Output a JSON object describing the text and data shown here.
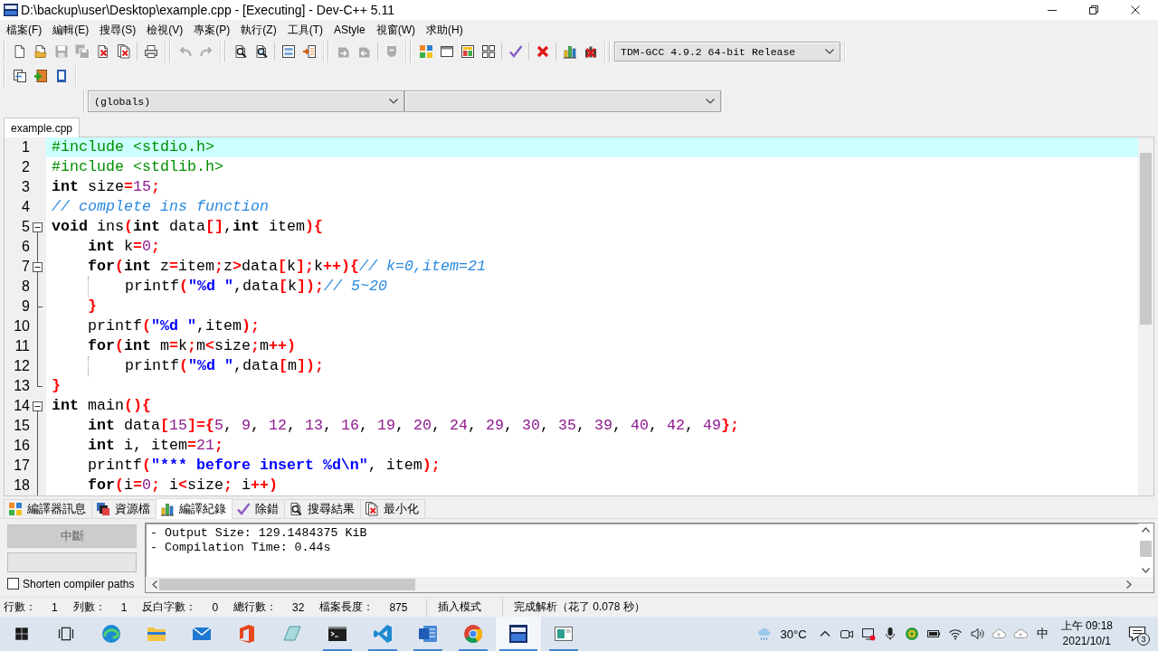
{
  "window": {
    "title": "D:\\backup\\user\\Desktop\\example.cpp - [Executing] - Dev-C++ 5.11"
  },
  "menu_bar": [
    "檔案(F)",
    "編輯(E)",
    "搜尋(S)",
    "檢視(V)",
    "專案(P)",
    "執行(Z)",
    "工具(T)",
    "AStyle",
    "視窗(W)",
    "求助(H)"
  ],
  "toolbar_rows": [
    {
      "bands": [
        {
          "groups": [
            [
              {
                "kind": "new",
                "disabled": false
              },
              {
                "kind": "open",
                "disabled": false
              },
              {
                "kind": "save",
                "disabled": true
              },
              {
                "kind": "saveall",
                "disabled": true
              },
              {
                "kind": "close",
                "disabled": false
              },
              {
                "kind": "closeall",
                "disabled": false
              }
            ],
            [
              {
                "kind": "print",
                "disabled": false
              }
            ]
          ]
        },
        {
          "groups": [
            [
              {
                "kind": "undo",
                "disabled": true
              },
              {
                "kind": "redo",
                "disabled": true
              }
            ]
          ]
        },
        {
          "groups": [
            [
              {
                "kind": "find",
                "disabled": false
              },
              {
                "kind": "replace",
                "disabled": false
              }
            ],
            [
              {
                "kind": "panel",
                "disabled": false
              },
              {
                "kind": "goto",
                "disabled": false
              }
            ]
          ]
        },
        {
          "groups": [
            [
              {
                "kind": "fileadd",
                "disabled": true
              },
              {
                "kind": "fileremove",
                "disabled": true
              }
            ],
            [
              {
                "kind": "options",
                "disabled": true
              }
            ]
          ]
        },
        {
          "groups": [
            [
              {
                "kind": "compile",
                "disabled": false
              },
              {
                "kind": "run",
                "disabled": false
              },
              {
                "kind": "compilerun",
                "disabled": false
              },
              {
                "kind": "rebuild",
                "disabled": false
              }
            ],
            [
              {
                "kind": "check",
                "disabled": false
              }
            ],
            [
              {
                "kind": "stop",
                "disabled": false
              }
            ],
            [
              {
                "kind": "profile",
                "disabled": false
              },
              {
                "kind": "deleteprofile",
                "disabled": false
              }
            ]
          ]
        }
      ]
    },
    {
      "bands": [
        {
          "groups": [
            [
              {
                "kind": "frames",
                "disabled": false
              },
              {
                "kind": "addfile",
                "disabled": false
              },
              {
                "kind": "book",
                "disabled": false
              }
            ]
          ]
        }
      ]
    }
  ],
  "compiler_select": {
    "value": "TDM-GCC 4.9.2 64-bit Release"
  },
  "scope_select": {
    "value": "(globals)"
  },
  "editor_tabs": [
    {
      "label": "example.cpp",
      "selected": true
    }
  ],
  "editor": {
    "lines": [
      {
        "number": "1",
        "current": true,
        "kind": "plain",
        "tokens": [
          {
            "kind": "pre",
            "text": "#include <stdio.h>"
          }
        ]
      },
      {
        "number": "2",
        "current": false,
        "kind": "plain",
        "tokens": [
          {
            "kind": "pre",
            "text": "#include <stdlib.h>"
          }
        ]
      },
      {
        "number": "3",
        "current": false,
        "kind": "plain",
        "tokens": [
          {
            "kind": "kw",
            "text": "int"
          },
          {
            "kind": "id",
            "text": " size"
          },
          {
            "kind": "sym",
            "text": "="
          },
          {
            "kind": "num",
            "text": "15"
          },
          {
            "kind": "sym",
            "text": ";"
          }
        ]
      },
      {
        "number": "4",
        "current": false,
        "kind": "plain",
        "tokens": [
          {
            "kind": "cmt",
            "text": "// complete ins function"
          }
        ]
      },
      {
        "number": "5",
        "current": false,
        "kind": "start",
        "tokens": [
          {
            "kind": "kw",
            "text": "void"
          },
          {
            "kind": "id",
            "text": " ins"
          },
          {
            "kind": "sym",
            "text": "("
          },
          {
            "kind": "kw",
            "text": "int"
          },
          {
            "kind": "id",
            "text": " data"
          },
          {
            "kind": "sym",
            "text": "[]"
          },
          {
            "kind": "id",
            "text": ","
          },
          {
            "kind": "kw",
            "text": "int"
          },
          {
            "kind": "id",
            "text": " item"
          },
          {
            "kind": "sym",
            "text": "){"
          }
        ]
      },
      {
        "number": "6",
        "current": false,
        "kind": "body",
        "tokens": [
          {
            "kind": "kw",
            "text": "    int"
          },
          {
            "kind": "id",
            "text": " k"
          },
          {
            "kind": "sym",
            "text": "="
          },
          {
            "kind": "num",
            "text": "0"
          },
          {
            "kind": "sym",
            "text": ";"
          }
        ]
      },
      {
        "number": "7",
        "current": false,
        "kind": "branch",
        "tokens": [
          {
            "kind": "kw",
            "text": "    for"
          },
          {
            "kind": "sym",
            "text": "("
          },
          {
            "kind": "kw",
            "text": "int"
          },
          {
            "kind": "id",
            "text": " z"
          },
          {
            "kind": "sym",
            "text": "="
          },
          {
            "kind": "id",
            "text": "item"
          },
          {
            "kind": "sym",
            "text": ";"
          },
          {
            "kind": "id",
            "text": "z"
          },
          {
            "kind": "sym",
            "text": ">"
          },
          {
            "kind": "id",
            "text": "data"
          },
          {
            "kind": "sym",
            "text": "["
          },
          {
            "kind": "id",
            "text": "k"
          },
          {
            "kind": "sym",
            "text": "];"
          },
          {
            "kind": "id",
            "text": "k"
          },
          {
            "kind": "sym",
            "text": "++){"
          },
          {
            "kind": "cmt",
            "text": "// k=0,item=21"
          }
        ]
      },
      {
        "number": "8",
        "current": false,
        "kind": "body",
        "tokens": [
          {
            "kind": "id",
            "text": "        printf"
          },
          {
            "kind": "sym",
            "text": "("
          },
          {
            "kind": "str",
            "text": "\"%d \""
          },
          {
            "kind": "id",
            "text": ",data"
          },
          {
            "kind": "sym",
            "text": "["
          },
          {
            "kind": "id",
            "text": "k"
          },
          {
            "kind": "sym",
            "text": "]);"
          },
          {
            "kind": "cmt",
            "text": "// 5~20"
          }
        ]
      },
      {
        "number": "9",
        "current": false,
        "kind": "tee",
        "tokens": [
          {
            "kind": "sym",
            "text": "    }"
          }
        ]
      },
      {
        "number": "10",
        "current": false,
        "kind": "body",
        "tokens": [
          {
            "kind": "id",
            "text": "    printf"
          },
          {
            "kind": "sym",
            "text": "("
          },
          {
            "kind": "str",
            "text": "\"%d \""
          },
          {
            "kind": "id",
            "text": ",item"
          },
          {
            "kind": "sym",
            "text": ");"
          }
        ]
      },
      {
        "number": "11",
        "current": false,
        "kind": "body",
        "tokens": [
          {
            "kind": "kw",
            "text": "    for"
          },
          {
            "kind": "sym",
            "text": "("
          },
          {
            "kind": "kw",
            "text": "int"
          },
          {
            "kind": "id",
            "text": " m"
          },
          {
            "kind": "sym",
            "text": "="
          },
          {
            "kind": "id",
            "text": "k"
          },
          {
            "kind": "sym",
            "text": ";"
          },
          {
            "kind": "id",
            "text": "m"
          },
          {
            "kind": "sym",
            "text": "<"
          },
          {
            "kind": "id",
            "text": "size"
          },
          {
            "kind": "sym",
            "text": ";"
          },
          {
            "kind": "id",
            "text": "m"
          },
          {
            "kind": "sym",
            "text": "++)"
          }
        ]
      },
      {
        "number": "12",
        "current": false,
        "kind": "body",
        "tokens": [
          {
            "kind": "id",
            "text": "        printf"
          },
          {
            "kind": "sym",
            "text": "("
          },
          {
            "kind": "str",
            "text": "\"%d \""
          },
          {
            "kind": "id",
            "text": ",data"
          },
          {
            "kind": "sym",
            "text": "["
          },
          {
            "kind": "id",
            "text": "m"
          },
          {
            "kind": "sym",
            "text": "]);"
          }
        ]
      },
      {
        "number": "13",
        "current": false,
        "kind": "end",
        "tokens": [
          {
            "kind": "sym",
            "text": "}"
          }
        ]
      },
      {
        "number": "14",
        "current": false,
        "kind": "start",
        "tokens": [
          {
            "kind": "kw",
            "text": "int"
          },
          {
            "kind": "id",
            "text": " main"
          },
          {
            "kind": "sym",
            "text": "(){"
          }
        ]
      },
      {
        "number": "15",
        "current": false,
        "kind": "body",
        "tokens": [
          {
            "kind": "kw",
            "text": "    int"
          },
          {
            "kind": "id",
            "text": " data"
          },
          {
            "kind": "sym",
            "text": "["
          },
          {
            "kind": "num",
            "text": "15"
          },
          {
            "kind": "sym",
            "text": "]={"
          },
          {
            "kind": "num",
            "text": "5"
          },
          {
            "kind": "id",
            "text": ", "
          },
          {
            "kind": "num",
            "text": "9"
          },
          {
            "kind": "id",
            "text": ", "
          },
          {
            "kind": "num",
            "text": "12"
          },
          {
            "kind": "id",
            "text": ", "
          },
          {
            "kind": "num",
            "text": "13"
          },
          {
            "kind": "id",
            "text": ", "
          },
          {
            "kind": "num",
            "text": "16"
          },
          {
            "kind": "id",
            "text": ", "
          },
          {
            "kind": "num",
            "text": "19"
          },
          {
            "kind": "id",
            "text": ", "
          },
          {
            "kind": "num",
            "text": "20"
          },
          {
            "kind": "id",
            "text": ", "
          },
          {
            "kind": "num",
            "text": "24"
          },
          {
            "kind": "id",
            "text": ", "
          },
          {
            "kind": "num",
            "text": "29"
          },
          {
            "kind": "id",
            "text": ", "
          },
          {
            "kind": "num",
            "text": "30"
          },
          {
            "kind": "id",
            "text": ", "
          },
          {
            "kind": "num",
            "text": "35"
          },
          {
            "kind": "id",
            "text": ", "
          },
          {
            "kind": "num",
            "text": "39"
          },
          {
            "kind": "id",
            "text": ", "
          },
          {
            "kind": "num",
            "text": "40"
          },
          {
            "kind": "id",
            "text": ", "
          },
          {
            "kind": "num",
            "text": "42"
          },
          {
            "kind": "id",
            "text": ", "
          },
          {
            "kind": "num",
            "text": "49"
          },
          {
            "kind": "sym",
            "text": "};"
          }
        ]
      },
      {
        "number": "16",
        "current": false,
        "kind": "body",
        "tokens": [
          {
            "kind": "kw",
            "text": "    int"
          },
          {
            "kind": "id",
            "text": " i, item"
          },
          {
            "kind": "sym",
            "text": "="
          },
          {
            "kind": "num",
            "text": "21"
          },
          {
            "kind": "sym",
            "text": ";"
          }
        ]
      },
      {
        "number": "17",
        "current": false,
        "kind": "body",
        "tokens": [
          {
            "kind": "id",
            "text": "    printf"
          },
          {
            "kind": "sym",
            "text": "("
          },
          {
            "kind": "str",
            "text": "\"*** before insert %d\\n\""
          },
          {
            "kind": "id",
            "text": ", item"
          },
          {
            "kind": "sym",
            "text": ");"
          }
        ]
      },
      {
        "number": "18",
        "current": false,
        "kind": "body",
        "tokens": [
          {
            "kind": "kw",
            "text": "    for"
          },
          {
            "kind": "sym",
            "text": "("
          },
          {
            "kind": "id",
            "text": "i"
          },
          {
            "kind": "sym",
            "text": "="
          },
          {
            "kind": "num",
            "text": "0"
          },
          {
            "kind": "sym",
            "text": ";"
          },
          {
            "kind": "id",
            "text": " i"
          },
          {
            "kind": "sym",
            "text": "<"
          },
          {
            "kind": "id",
            "text": "size"
          },
          {
            "kind": "sym",
            "text": ";"
          },
          {
            "kind": "id",
            "text": " i"
          },
          {
            "kind": "sym",
            "text": "++)"
          }
        ]
      }
    ]
  },
  "panel_tabs": [
    {
      "label": "編譯器訊息",
      "kind": "compile",
      "selected": false
    },
    {
      "label": "資源檔",
      "kind": "stack",
      "selected": false
    },
    {
      "label": "編譯紀錄",
      "kind": "profile",
      "selected": true
    },
    {
      "label": "除錯",
      "kind": "check",
      "selected": false
    },
    {
      "label": "搜尋結果",
      "kind": "find",
      "selected": false
    },
    {
      "label": "最小化",
      "kind": "closeall",
      "selected": false
    }
  ],
  "compile_log": {
    "abort_button": {
      "label": "中斷",
      "disabled": true
    },
    "shorten_paths": {
      "label": "Shorten compiler paths",
      "checked": false
    },
    "output": [
      "- Output Size: 129.1484375 KiB",
      "- Compilation Time: 0.44s"
    ]
  },
  "status_bar": {
    "fields": [
      {
        "label": "行數：",
        "value": "1"
      },
      {
        "label": "列數：",
        "value": "1"
      },
      {
        "label": "反白字數：",
        "value": "0"
      },
      {
        "label": "總行數：",
        "value": "32"
      },
      {
        "label": "檔案長度：",
        "value": "875"
      }
    ],
    "mode": "插入模式",
    "message": "完成解析（花了 0.078 秒）"
  },
  "taskbar": {
    "apps": [
      {
        "kind": "start",
        "running": false,
        "selected": false
      },
      {
        "kind": "taskview",
        "running": false,
        "selected": false
      },
      {
        "kind": "edge",
        "running": false,
        "selected": false
      },
      {
        "kind": "explorer",
        "running": false,
        "selected": false
      },
      {
        "kind": "mail",
        "running": false,
        "selected": false
      },
      {
        "kind": "office",
        "running": false,
        "selected": false
      },
      {
        "kind": "notes",
        "running": false,
        "selected": false
      },
      {
        "kind": "terminal",
        "running": true,
        "selected": false
      },
      {
        "kind": "vscode",
        "running": true,
        "selected": false
      },
      {
        "kind": "word",
        "running": true,
        "selected": false
      },
      {
        "kind": "chrome",
        "running": true,
        "selected": false
      },
      {
        "kind": "devcpp",
        "running": true,
        "selected": true
      },
      {
        "kind": "app",
        "running": true,
        "selected": false
      }
    ],
    "weather": "30°C",
    "ime": "中",
    "time": "上午 09:18",
    "date": "2021/10/1",
    "notifications": "3"
  }
}
